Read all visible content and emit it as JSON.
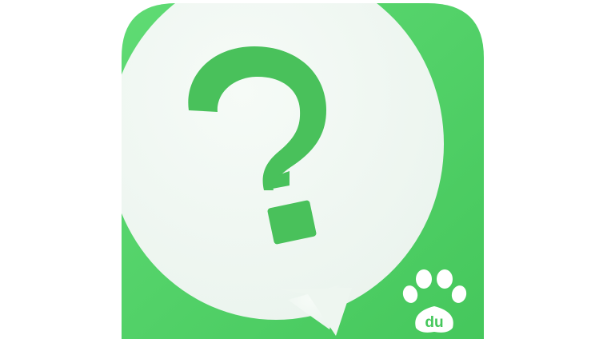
{
  "icon": {
    "name": "baidu-zhidao-app-icon",
    "badge_text": "du"
  },
  "colors": {
    "tile_green": "#4ccc62",
    "tile_green_light": "#5fdb74",
    "bubble_fill": "#f2f8f4",
    "glyph_green": "#49c15b",
    "paw_white": "#ffffff",
    "background": "#ffffff"
  }
}
